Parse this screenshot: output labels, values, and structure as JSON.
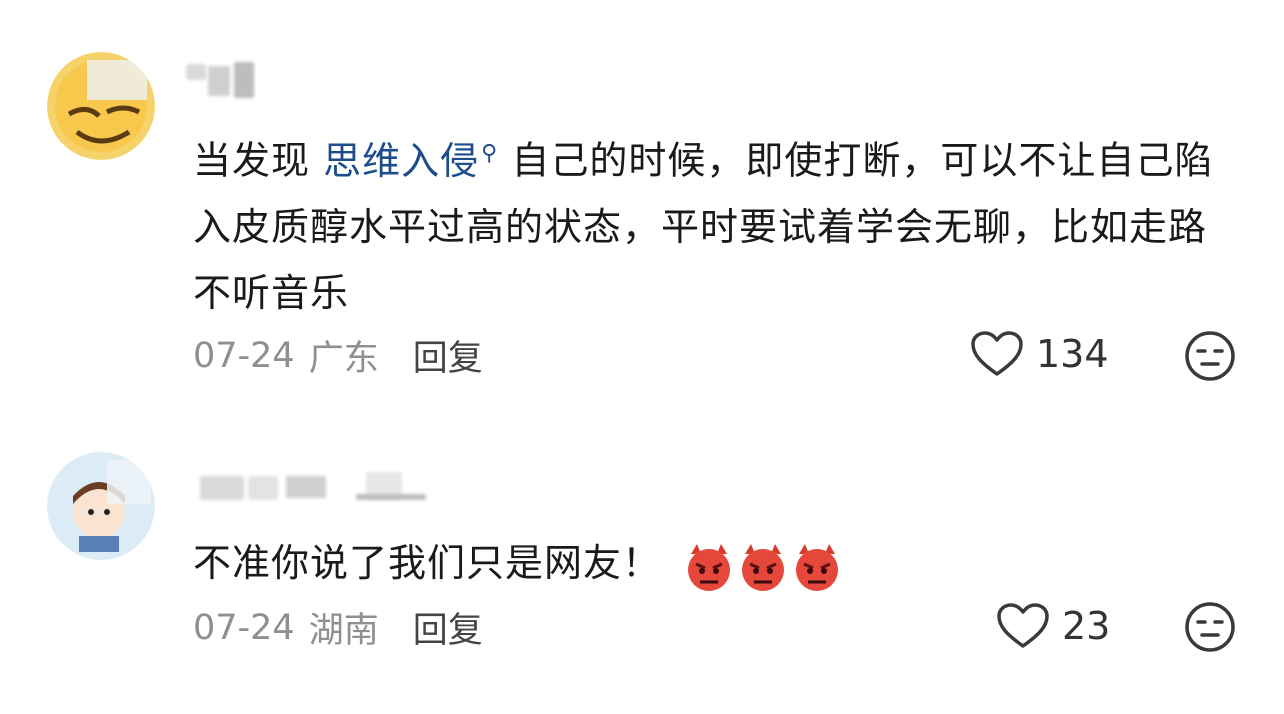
{
  "comments": [
    {
      "text_before": "当发现 ",
      "topic": "思维入侵",
      "text_after": " 自己的时候，即使打断，可以不让自己陷入皮质醇水平过高的状态，平时要试着学会无聊，比如走路不听音乐",
      "date": "07-24",
      "location": "广东",
      "reply_label": "回复",
      "likes": "134"
    },
    {
      "text": "不准你说了我们只是网友！",
      "date": "07-24",
      "location": "湖南",
      "reply_label": "回复",
      "likes": "23"
    }
  ],
  "colors": {
    "topic_link": "#1e4d8c",
    "meta_gray": "#8f8f8f"
  },
  "icons": [
    "heart-icon",
    "neutral-face-icon",
    "angry-devil-emoji",
    "search-icon"
  ]
}
